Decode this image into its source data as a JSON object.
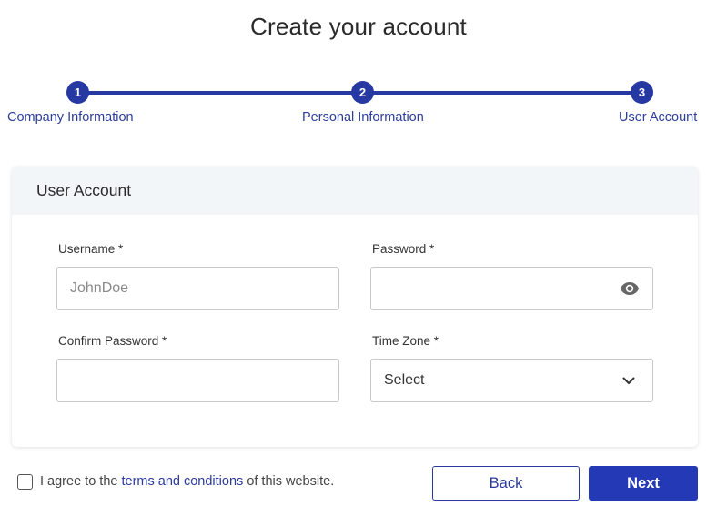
{
  "page": {
    "title": "Create your account"
  },
  "stepper": {
    "steps": [
      {
        "number": "1",
        "label": "Company Information"
      },
      {
        "number": "2",
        "label": "Personal Information"
      },
      {
        "number": "3",
        "label": "User Account"
      }
    ],
    "active_step": 3,
    "accent_color": "#2639a3"
  },
  "card": {
    "header": "User Account",
    "fields": {
      "username": {
        "label": "Username *",
        "placeholder": "JohnDoe",
        "value": ""
      },
      "password": {
        "label": "Password *",
        "value": "",
        "icon": "eye-icon"
      },
      "confirm_password": {
        "label": "Confirm Password *",
        "value": ""
      },
      "time_zone": {
        "label": "Time Zone *",
        "selected": "Select",
        "icon": "chevron-down-icon"
      }
    }
  },
  "footer": {
    "agree_prefix": "I agree to the",
    "terms_link": "terms and conditions",
    "agree_suffix": "of this website.",
    "agree_checked": false,
    "back_label": "Back",
    "next_label": "Next"
  }
}
